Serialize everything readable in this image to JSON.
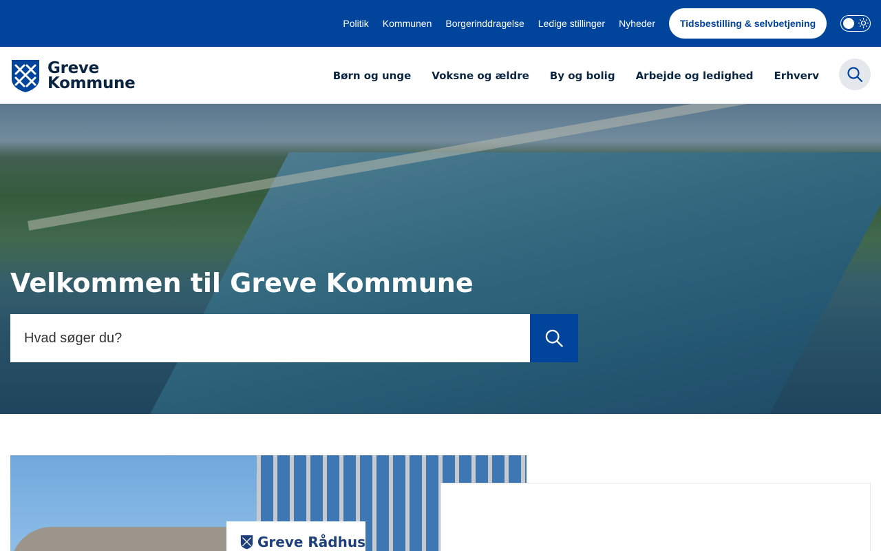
{
  "top_nav": {
    "links": [
      "Politik",
      "Kommunen",
      "Borgerinddragelse",
      "Ledige stillinger",
      "Nyheder"
    ],
    "cta_label": "Tidsbestilling & selvbetjening"
  },
  "header": {
    "logo_line1": "Greve",
    "logo_line2": "Kommune",
    "nav": [
      "Børn og unge",
      "Voksne og ældre",
      "By og bolig",
      "Arbejde og ledighed",
      "Erhverv"
    ]
  },
  "hero": {
    "title": "Velkommen til Greve Kommune",
    "search_placeholder": "Hvad søger du?"
  },
  "feature": {
    "sign_text": "Greve Rådhus"
  },
  "colors": {
    "brand_blue": "#00449c",
    "text_dark": "#0b2540"
  },
  "icons": [
    "search-icon",
    "theme-toggle-sun-icon",
    "greve-logo-icon"
  ]
}
